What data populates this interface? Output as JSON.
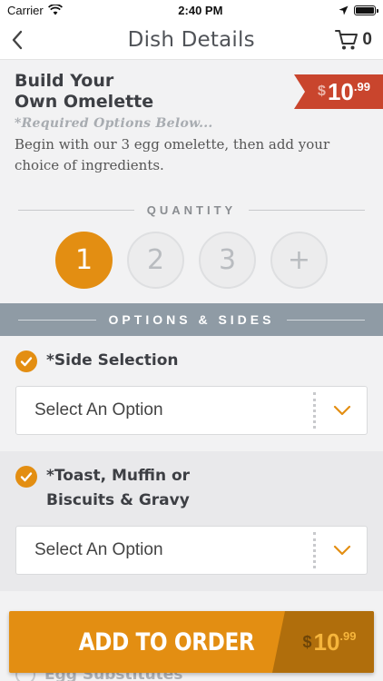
{
  "status_bar": {
    "carrier": "Carrier",
    "time": "2:40 PM"
  },
  "nav": {
    "title": "Dish Details",
    "cart_count": "0"
  },
  "dish": {
    "title_line1": "Build Your",
    "title_line2": "Own Omelette",
    "price_currency": "$",
    "price_amount": "10",
    "price_cents": ".99",
    "required_note": "*Required Options Below...",
    "description": "Begin with our 3 egg omelette, then add your choice of ingredients."
  },
  "quantity": {
    "label": "QUANTITY",
    "options": [
      "1",
      "2",
      "3",
      "+"
    ],
    "selected": "1"
  },
  "options_banner": {
    "label": "OPTIONS & SIDES"
  },
  "sections": [
    {
      "title_line1": "*Side Selection",
      "title_line2": "",
      "select_value": "Select An Option"
    },
    {
      "title_line1": "*Toast, Muffin or",
      "title_line2": "Biscuits & Gravy",
      "select_value": "Select An Option"
    },
    {
      "title_line1": "Egg Substitutes",
      "title_line2": "",
      "select_value": ""
    }
  ],
  "add_to_order": {
    "label": "ADD TO ORDER",
    "price_currency": "$",
    "price_amount": "10",
    "price_cents": ".99"
  },
  "colors": {
    "accent": "#e38e12",
    "price_tag": "#c9452d",
    "banner": "#8f9ba5"
  }
}
